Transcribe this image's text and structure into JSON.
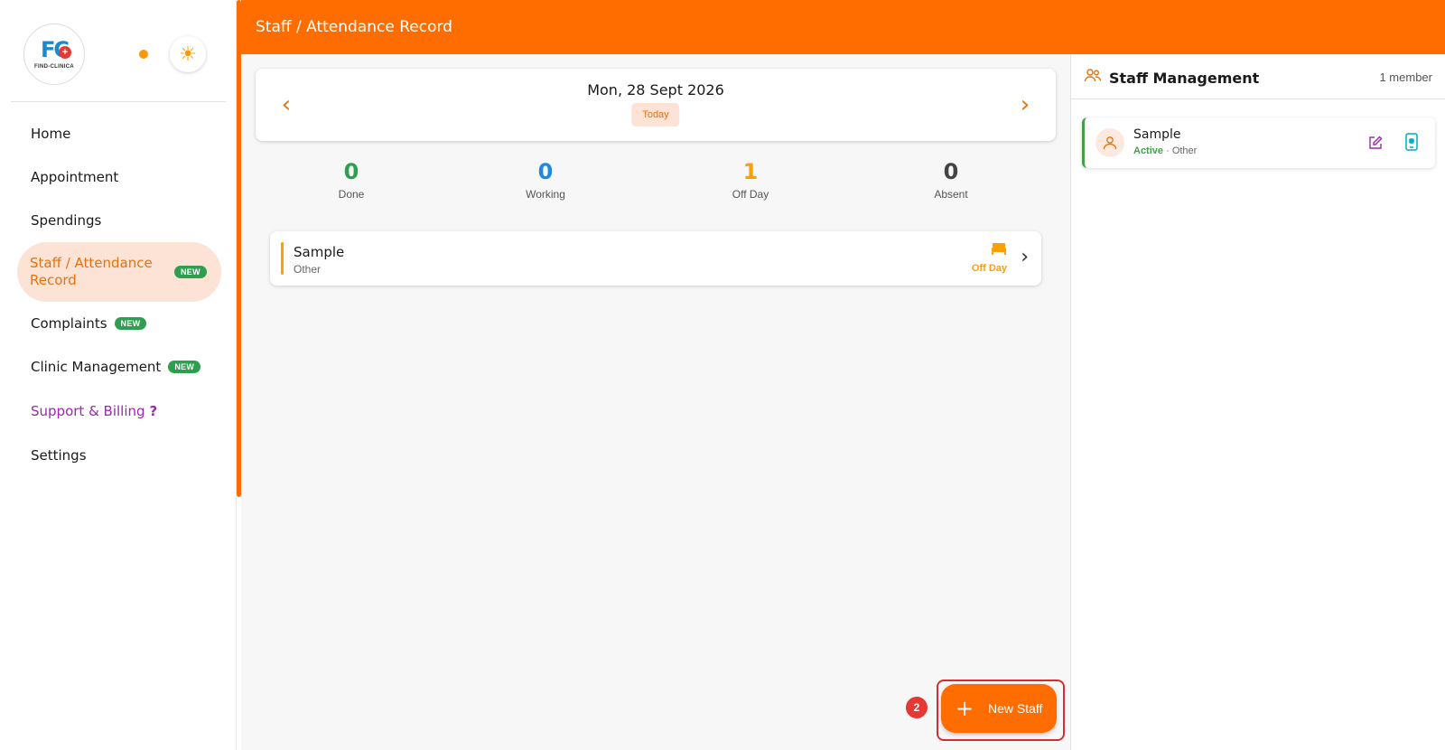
{
  "brand": {
    "logo_text": "FC",
    "logo_caption": "FIND-CLINICA"
  },
  "sidebar": {
    "items": [
      {
        "label": "Home"
      },
      {
        "label": "Appointment"
      },
      {
        "label": "Spendings"
      },
      {
        "label": "Staff / Attendance Record",
        "badge": "NEW"
      },
      {
        "label": "Complaints",
        "badge": "NEW"
      },
      {
        "label": "Clinic Management",
        "badge": "NEW"
      },
      {
        "label": "Support & Billing",
        "suffix": "?"
      },
      {
        "label": "Settings"
      }
    ]
  },
  "header": {
    "title": "Staff / Attendance Record"
  },
  "date_nav": {
    "date": "Mon, 28 Sept 2026",
    "today_label": "Today"
  },
  "stats": [
    {
      "value": "0",
      "label": "Done",
      "color": "#2e9e4f"
    },
    {
      "value": "0",
      "label": "Working",
      "color": "#1e88e5"
    },
    {
      "value": "1",
      "label": "Off Day",
      "color": "#ffa000"
    },
    {
      "value": "0",
      "label": "Absent",
      "color": "#444444"
    }
  ],
  "attendance": [
    {
      "name": "Sample",
      "role": "Other",
      "status": "Off Day"
    }
  ],
  "panel": {
    "title": "Staff Management",
    "count": "1 member",
    "members": [
      {
        "name": "Sample",
        "status": "Active",
        "role": "· Other"
      }
    ]
  },
  "fab": {
    "label": "New Staff",
    "step": "2"
  },
  "colors": {
    "accent": "#ff6d00",
    "active_bg": "#fde3d6",
    "badge": "#2e9e4f",
    "support": "#9c27b0"
  }
}
